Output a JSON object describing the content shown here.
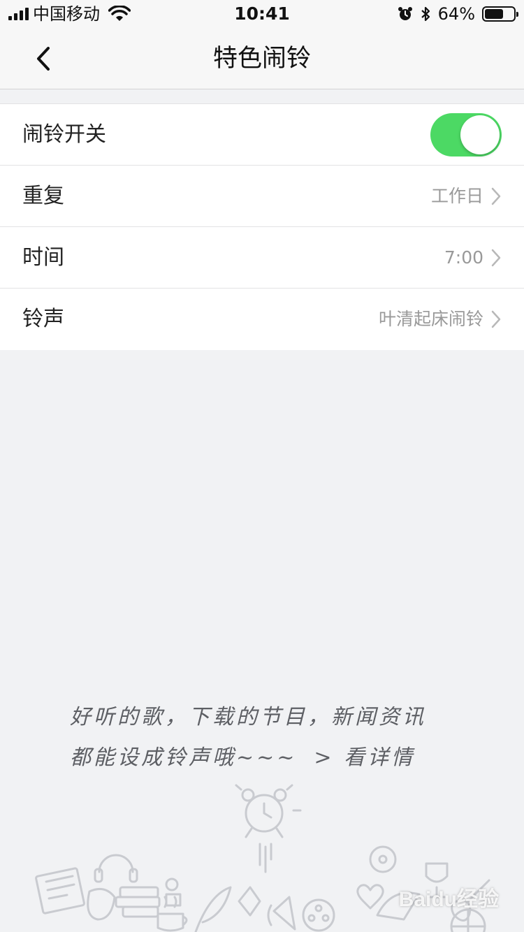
{
  "status_bar": {
    "carrier": "中国移动",
    "time": "10:41",
    "battery_percent_label": "64%",
    "battery_level": 0.64
  },
  "nav": {
    "title": "特色闹铃"
  },
  "settings": {
    "alarm_switch": {
      "label": "闹铃开关",
      "enabled": true
    },
    "repeat": {
      "label": "重复",
      "value": "工作日"
    },
    "time": {
      "label": "时间",
      "value": "7:00"
    },
    "ringtone": {
      "label": "铃声",
      "value": "叶清起床闹铃"
    }
  },
  "promo": {
    "line1": "好听的歌，下载的节目，新闻资讯",
    "line2": "都能设成铃声哦~~~",
    "link": "> 看详情"
  },
  "watermark": "Baidu经验",
  "colors": {
    "toggle_on": "#4cd964",
    "background": "#f1f2f4",
    "value_text": "#999999"
  }
}
